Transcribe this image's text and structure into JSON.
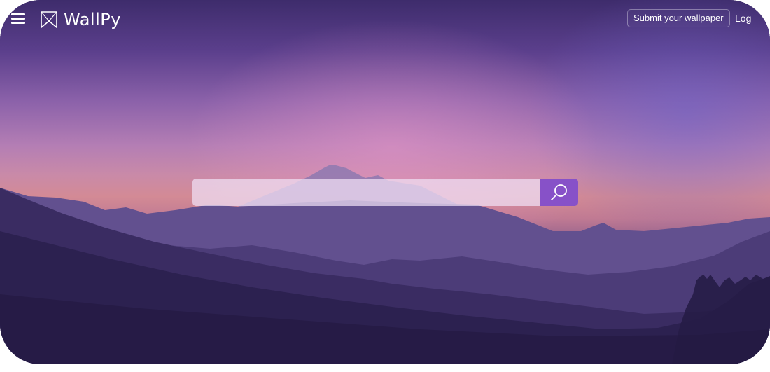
{
  "app": {
    "name": "WallPy"
  },
  "header": {
    "menu_icon": "hamburger-menu-icon",
    "logo_icon": "bookmark-logo-icon",
    "submit_label": "Submit your wallpaper",
    "login_label": "Log"
  },
  "search": {
    "value": "",
    "placeholder": "",
    "button_icon": "search-icon"
  },
  "colors": {
    "accent": "#8751c8",
    "text": "#ffffff"
  }
}
